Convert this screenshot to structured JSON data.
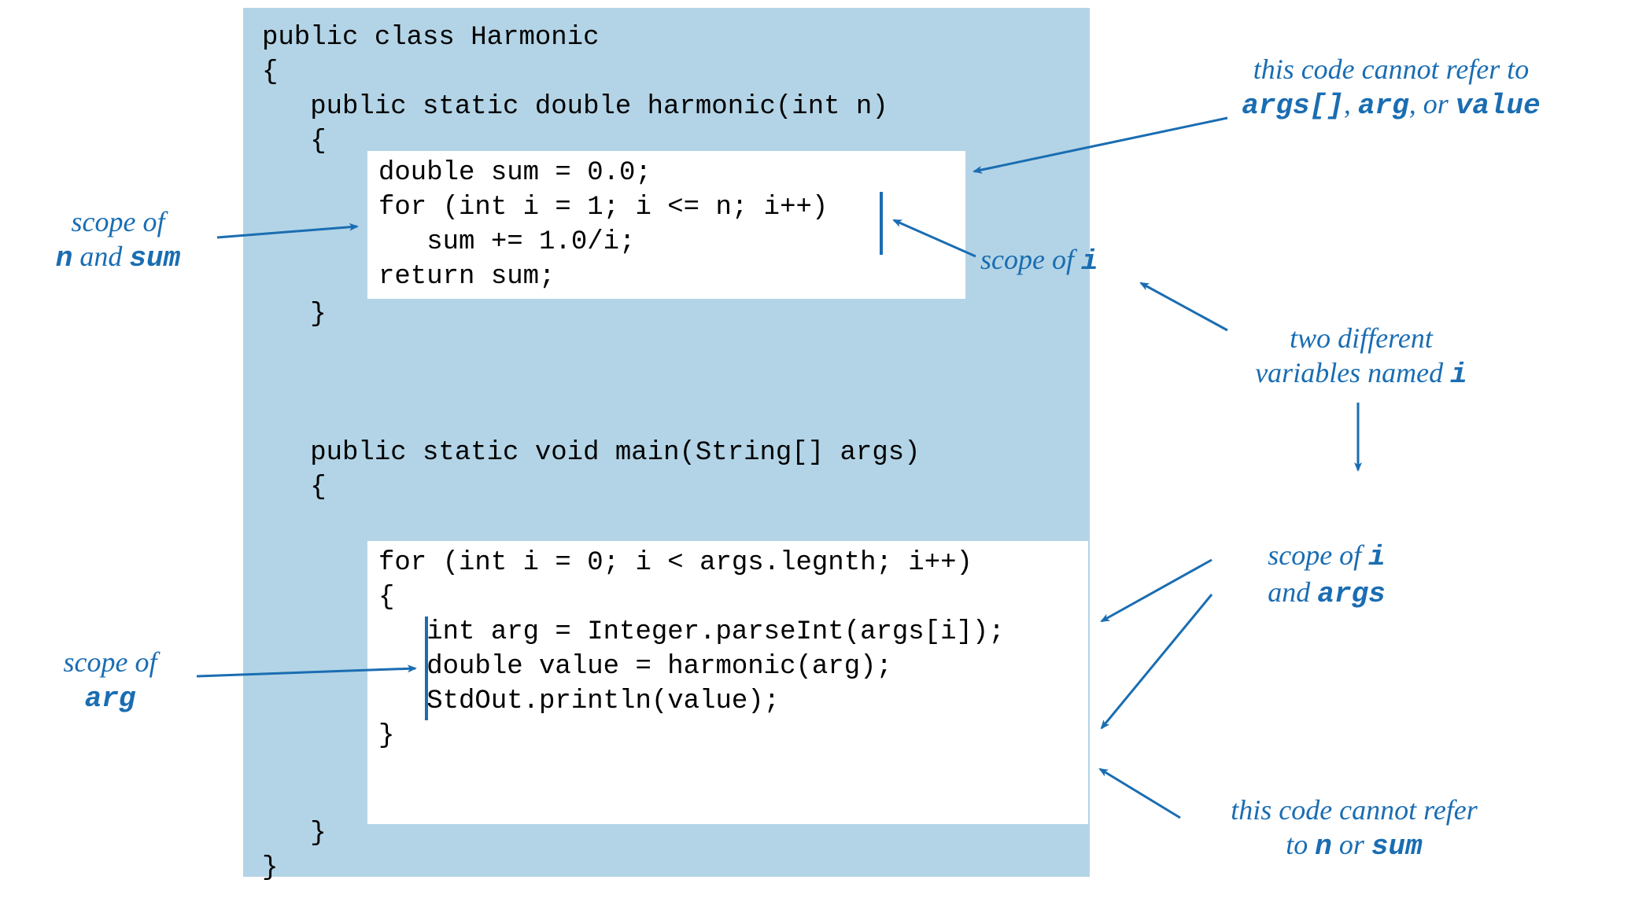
{
  "colors": {
    "panel_bg": "#b3d4e6",
    "accent": "#1a6db2"
  },
  "code": {
    "line1": "public class Harmonic",
    "line2": "{",
    "line3": "   public static double harmonic(int n)",
    "line4": "   {",
    "blockA1": "double sum = 0.0;",
    "blockA2": "for (int i = 1; i <= n; i++)",
    "blockA3": "   sum += 1.0/i;",
    "blockA4": "return sum;",
    "line5": "   }",
    "lineblank": "",
    "line6": "   public static void main(String[] args)",
    "line7": "   {",
    "blockB1": "for (int i = 0; i < args.legnth; i++)",
    "blockB2": "{",
    "blockB3": "   int arg = Integer.parseInt(args[i]);",
    "blockB4": "   double value = harmonic(arg);",
    "blockB5": "   StdOut.println(value);",
    "blockB6": "}",
    "line8": "   }",
    "line9": "}"
  },
  "annotations": {
    "left1_a": "scope of",
    "left1_b_pre": "n",
    "left1_b_mid": " and ",
    "left1_b_post": "sum",
    "left2_a": "scope of",
    "left2_b": "arg",
    "right1_a": "this code cannot refer to",
    "right1_b_1": "args[]",
    "right1_b_sep1": ", ",
    "right1_b_2": "arg",
    "right1_b_sep2": ", or ",
    "right1_b_3": "value",
    "right2_pre": "scope of ",
    "right2_var": "i",
    "right3_a": "two different",
    "right3_b_pre": "variables named ",
    "right3_b_var": "i",
    "right4_a_pre": "scope of ",
    "right4_a_var": "i",
    "right4_b_pre": "and ",
    "right4_b_var": "args",
    "right5_a": "this code cannot refer",
    "right5_b_pre": "to ",
    "right5_b_1": "n",
    "right5_b_mid": " or ",
    "right5_b_2": "sum"
  }
}
